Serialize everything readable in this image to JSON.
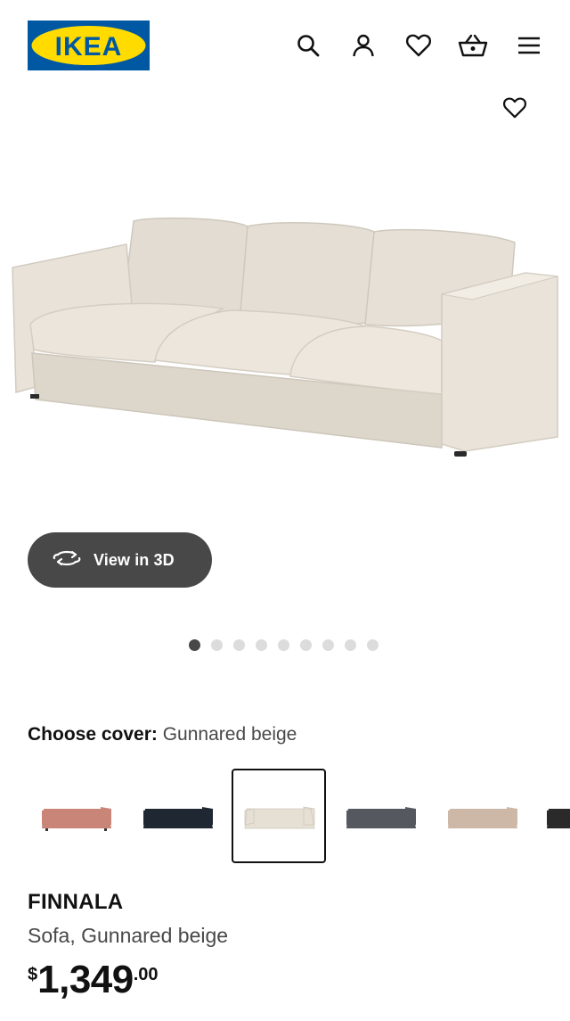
{
  "header": {
    "logo_text": "IKEA",
    "icons": [
      "search-icon",
      "account-icon",
      "favourites-icon",
      "cart-icon",
      "menu-icon"
    ]
  },
  "gallery": {
    "view_3d_label": "View in 3D",
    "image_count": 9,
    "active_index": 0
  },
  "cover": {
    "label": "Choose cover:",
    "value": "Gunnared beige",
    "options": [
      {
        "color": "#c98578"
      },
      {
        "color": "#1f2733"
      },
      {
        "color": "#e6dfd4"
      },
      {
        "color": "#55585e"
      },
      {
        "color": "#cdb8a8"
      },
      {
        "color": "#2a2a2a"
      }
    ],
    "selected_index": 2
  },
  "product": {
    "name": "FINNALA",
    "description": "Sofa, Gunnared beige",
    "price_currency": "$",
    "price_whole": "1,349",
    "price_decimal": ".00"
  },
  "colors": {
    "brand_blue": "#0058a3",
    "brand_yellow": "#ffdb00",
    "button_dark": "#484848"
  }
}
